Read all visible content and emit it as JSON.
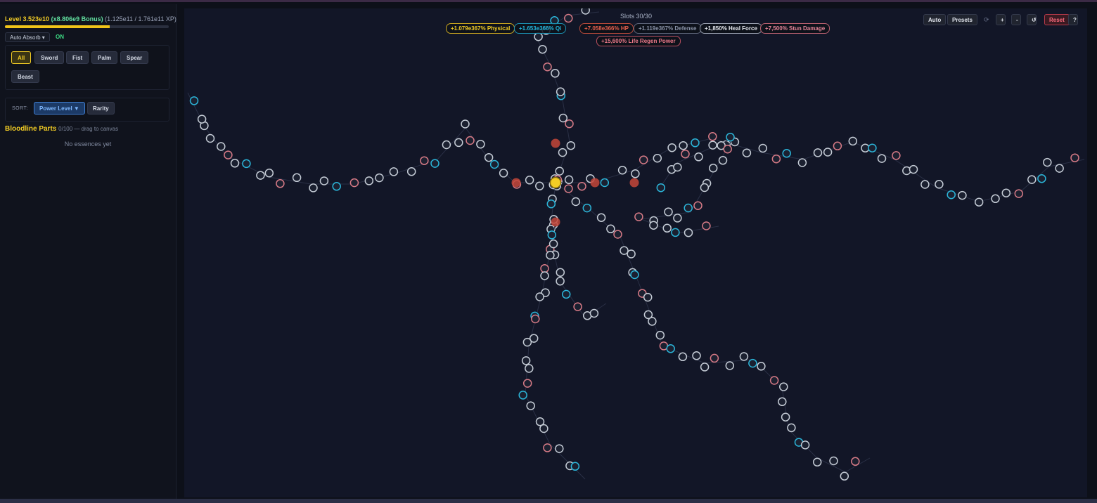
{
  "sidebar": {
    "level_text": "Level 3.523e10",
    "bonus_text": "(x8.806e9 Bonus)",
    "xp_text": "(1.125e11 / 1.761e11 XP)",
    "xp_progress": 0.64,
    "auto_absorb_label": "Auto Absorb ▾",
    "auto_absorb_state": "ON",
    "filters": [
      "All",
      "Sword",
      "Fist",
      "Palm",
      "Spear",
      "Beast"
    ],
    "active_filter": "All",
    "sort_label": "SORT:",
    "sort_options": [
      "Power Level ▼",
      "Rarity"
    ],
    "bloodline_title": "Bloodline Parts",
    "bloodline_count": "0/100 — drag to canvas",
    "empty_text": "No essences yet"
  },
  "canvas": {
    "slots_text": "Slots 30/30",
    "stats": [
      {
        "text": "+1.079e367% Physical",
        "color": "#f3cd25"
      },
      {
        "text": "+1.653e366% Qi",
        "color": "#22b8e0"
      },
      {
        "text": "+7.058e366% HP",
        "color": "#e8604c"
      },
      {
        "text": "+1.119e367% Defense",
        "color": "#8a93a8"
      },
      {
        "text": "+1,850% Heal Force",
        "color": "#e6e9ef"
      },
      {
        "text": "+7,500% Stun Damage",
        "color": "#e8869a"
      },
      {
        "text": "+15,600% Life Regen Power",
        "color": "#ee7a8a"
      }
    ],
    "toolbar": {
      "auto": "Auto",
      "presets": "Presets",
      "refresh_icon": "⟳",
      "zoom_in": "+",
      "zoom_out": "-",
      "fit": "↺",
      "reset": "Reset",
      "help": "?"
    },
    "colors": {
      "white_node": "#c5ccd6",
      "blue_node": "#2bb5d9",
      "red_node": "#d77a86",
      "core": "#f3cd25",
      "active_red": "#c4463a"
    }
  }
}
